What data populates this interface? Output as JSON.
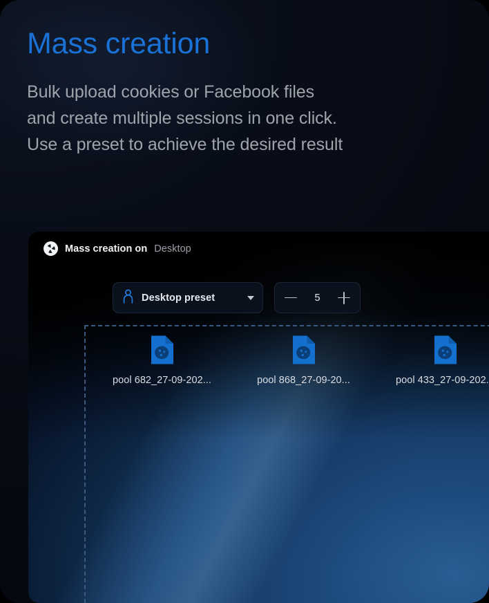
{
  "hero": {
    "title": "Mass creation",
    "subtitle": "Bulk upload cookies or Facebook files\nand create multiple sessions in one click.\nUse a preset to achieve the desired result",
    "title_color": "#1a71d6",
    "subtitle_color": "#9fa4ab"
  },
  "panel": {
    "brand_icon": "app-logo-icon",
    "title": "Mass creation on",
    "os": "Desktop",
    "accent_color": "#1f7ae0"
  },
  "controls": {
    "preset": {
      "icon": "user-icon",
      "value": "Desktop preset",
      "caret_icon": "chevron-down-icon"
    },
    "counter": {
      "decrement_icon": "minus-icon",
      "value": "5",
      "increment_icon": "plus-icon"
    }
  },
  "dropzone": {
    "files": [
      {
        "icon": "cookie-file-icon",
        "name": "pool 682_27-09-202..."
      },
      {
        "icon": "cookie-file-icon",
        "name": "pool 868_27-09-20..."
      },
      {
        "icon": "cookie-file-icon",
        "name": "pool 433_27-09-202..."
      }
    ]
  }
}
